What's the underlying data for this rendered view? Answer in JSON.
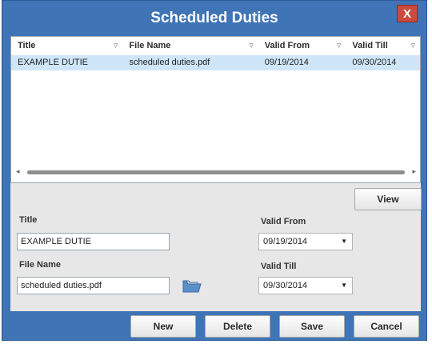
{
  "window": {
    "title": "Scheduled Duties",
    "close_label": "X"
  },
  "grid": {
    "columns": [
      {
        "label": "Title"
      },
      {
        "label": "File Name"
      },
      {
        "label": "Valid From"
      },
      {
        "label": "Valid Till"
      }
    ],
    "rows": [
      {
        "title": "EXAMPLE DUTIE",
        "file_name": "scheduled duties.pdf",
        "valid_from": "09/19/2014",
        "valid_till": "09/30/2014"
      }
    ]
  },
  "form": {
    "view_label": "View",
    "title_label": "Title",
    "title_value": "EXAMPLE DUTIE",
    "file_name_label": "File Name",
    "file_name_value": "scheduled duties.pdf",
    "valid_from_label": "Valid From",
    "valid_from_value": "09/19/2014",
    "valid_till_label": "Valid Till",
    "valid_till_value": "09/30/2014"
  },
  "footer": {
    "new_label": "New",
    "delete_label": "Delete",
    "save_label": "Save",
    "cancel_label": "Cancel"
  },
  "icons": {
    "filter": "funnel-icon",
    "folder": "folder-open-icon",
    "dropdown": "chevron-down-icon",
    "close": "close-icon"
  },
  "colors": {
    "window_blue": "#3f74b6",
    "selected_row": "#cfe6f8",
    "close_red": "#c94b40",
    "panel_gray": "#e7e7e7"
  }
}
